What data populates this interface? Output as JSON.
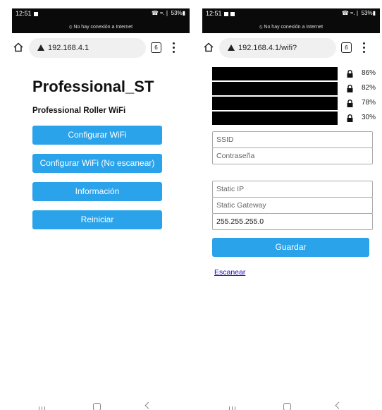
{
  "left": {
    "status": {
      "time": "12:51",
      "signal": "☎ ≈.❘ 53%▮",
      "network": "⦸ No hay conexión a Internet"
    },
    "url": "192.168.4.1",
    "tab_count": "6",
    "title": "Professional_ST",
    "subtitle": "Professional Roller WiFi",
    "buttons": [
      "Configurar WiFi",
      "Configurar WiFi (No escanear)",
      "Información",
      "Reiniciar"
    ]
  },
  "right": {
    "status": {
      "time": "12:51",
      "signal": "☎ ≈.❘ 53%▮",
      "network": "⦸ No hay conexión a Internet"
    },
    "url": "192.168.4.1/wifi?",
    "tab_count": "6",
    "networks": [
      {
        "signal": "86%"
      },
      {
        "signal": "82%"
      },
      {
        "signal": "78%"
      },
      {
        "signal": "30%"
      }
    ],
    "ssid_placeholder": "SSID",
    "password_placeholder": "Contraseña",
    "static_ip_placeholder": "Static IP",
    "static_gateway_placeholder": "Static Gateway",
    "subnet_value": "255.255.255.0",
    "save_label": "Guardar",
    "scan_label": "Escanear"
  },
  "colors": {
    "button": "#2aa3ea",
    "status_bar": "#0a0a0a"
  }
}
